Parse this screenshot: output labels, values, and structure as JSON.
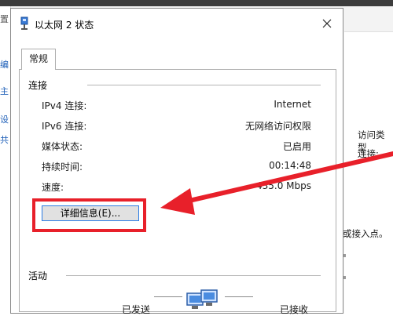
{
  "dialog": {
    "title": "以太网 2 状态",
    "tab_general": "常规",
    "section_connection": "连接",
    "rows": [
      {
        "label": "IPv4 连接:",
        "value": "Internet"
      },
      {
        "label": "IPv6 连接:",
        "value": "无网络访问权限"
      },
      {
        "label": "媒体状态:",
        "value": "已启用"
      },
      {
        "label": "持续时间:",
        "value": "00:14:48"
      },
      {
        "label": "速度:",
        "value": "435.0 Mbps"
      }
    ],
    "details_button": "详细信息(E)...",
    "section_activity": "活动",
    "sent_label": "已发送",
    "received_label": "已接收"
  },
  "background": {
    "left_chars": [
      "置",
      "编",
      "主",
      "设",
      "共"
    ],
    "right_labels": [
      "访问类型",
      "连接:"
    ],
    "bottom_text": "或接入点。"
  },
  "colors": {
    "annotation_red": "#e8202a",
    "focus_blue": "#2a7be4"
  }
}
